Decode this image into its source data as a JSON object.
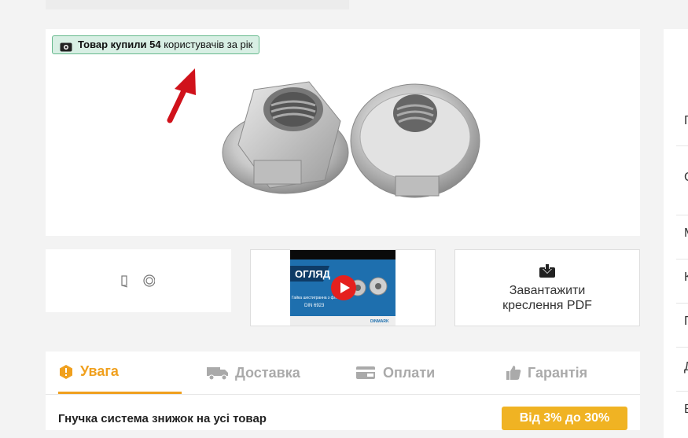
{
  "badge": {
    "text_bold": "Товар купили 54",
    "text_rest": " користувачів за рік",
    "icon": "eye-icon"
  },
  "video": {
    "overlay_title": "ОГЛЯД",
    "caption": "Гайка шестигранна з фл...",
    "standard": "DIN 6923",
    "brand": "DINMARK"
  },
  "pdf": {
    "line1": "Завантажити",
    "line2": "креслення PDF",
    "icon": "download-icon"
  },
  "tabs": [
    {
      "label": "Увага",
      "icon": "alert-icon",
      "active": true
    },
    {
      "label": "Доставка",
      "icon": "truck-icon",
      "active": false
    },
    {
      "label": "Оплати",
      "icon": "wallet-icon",
      "active": false
    },
    {
      "label": "Гарантія",
      "icon": "thumbs-up-icon",
      "active": false
    }
  ],
  "discount": {
    "text": "Гнучка система знижок на усі товар",
    "badge": "Від 3% до 30%"
  },
  "right_panel": {
    "letters": [
      "Г",
      "С",
      "М",
      "К",
      "Г",
      "Д",
      "В"
    ]
  },
  "colors": {
    "accent": "#f0a01e",
    "badge_bg": "#d8efe4",
    "badge_border": "#66b98d",
    "arrow": "#d0121b",
    "video_bg": "#1e6fae"
  }
}
